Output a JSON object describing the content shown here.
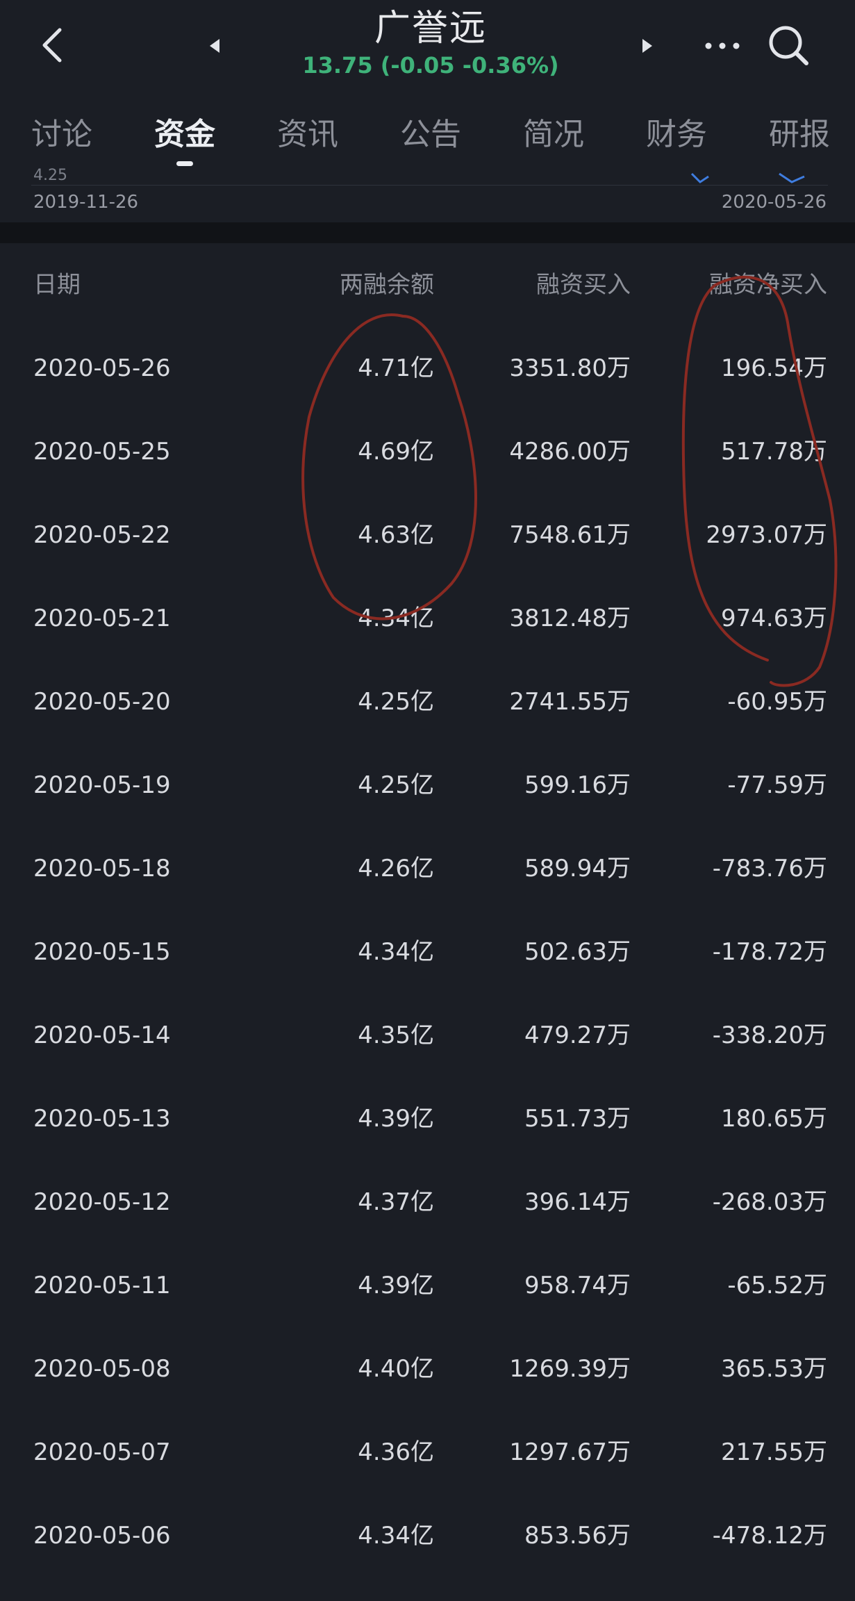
{
  "header": {
    "stock_name": "广誉远",
    "quote": "13.75 (-0.05 -0.36%)",
    "quote_color": "#3fb37a"
  },
  "tabs": [
    {
      "label": "讨论",
      "active": false
    },
    {
      "label": "资金",
      "active": true
    },
    {
      "label": "资讯",
      "active": false
    },
    {
      "label": "公告",
      "active": false
    },
    {
      "label": "简况",
      "active": false
    },
    {
      "label": "财务",
      "active": false
    },
    {
      "label": "研报",
      "active": false
    }
  ],
  "chart": {
    "partial_tick": "4.25",
    "start_date": "2019-11-26",
    "end_date": "2020-05-26"
  },
  "table": {
    "headers": {
      "date": "日期",
      "balance": "两融余额",
      "buy": "融资买入",
      "net": "融资净买入"
    },
    "rows": [
      {
        "date": "2020-05-26",
        "balance": "4.71亿",
        "buy": "3351.80万",
        "net": "196.54万"
      },
      {
        "date": "2020-05-25",
        "balance": "4.69亿",
        "buy": "4286.00万",
        "net": "517.78万"
      },
      {
        "date": "2020-05-22",
        "balance": "4.63亿",
        "buy": "7548.61万",
        "net": "2973.07万"
      },
      {
        "date": "2020-05-21",
        "balance": "4.34亿",
        "buy": "3812.48万",
        "net": "974.63万"
      },
      {
        "date": "2020-05-20",
        "balance": "4.25亿",
        "buy": "2741.55万",
        "net": "-60.95万"
      },
      {
        "date": "2020-05-19",
        "balance": "4.25亿",
        "buy": "599.16万",
        "net": "-77.59万"
      },
      {
        "date": "2020-05-18",
        "balance": "4.26亿",
        "buy": "589.94万",
        "net": "-783.76万"
      },
      {
        "date": "2020-05-15",
        "balance": "4.34亿",
        "buy": "502.63万",
        "net": "-178.72万"
      },
      {
        "date": "2020-05-14",
        "balance": "4.35亿",
        "buy": "479.27万",
        "net": "-338.20万"
      },
      {
        "date": "2020-05-13",
        "balance": "4.39亿",
        "buy": "551.73万",
        "net": "180.65万"
      },
      {
        "date": "2020-05-12",
        "balance": "4.37亿",
        "buy": "396.14万",
        "net": "-268.03万"
      },
      {
        "date": "2020-05-11",
        "balance": "4.39亿",
        "buy": "958.74万",
        "net": "-65.52万"
      },
      {
        "date": "2020-05-08",
        "balance": "4.40亿",
        "buy": "1269.39万",
        "net": "365.53万"
      },
      {
        "date": "2020-05-07",
        "balance": "4.36亿",
        "buy": "1297.67万",
        "net": "217.55万"
      },
      {
        "date": "2020-05-06",
        "balance": "4.34亿",
        "buy": "853.56万",
        "net": "-478.12万"
      }
    ]
  },
  "icons": {
    "back": "back-arrow-icon",
    "prev": "triangle-left-icon",
    "next": "triangle-right-icon",
    "more": "more-dots-icon",
    "search": "search-icon"
  },
  "annotation_color": "#8a2a22"
}
